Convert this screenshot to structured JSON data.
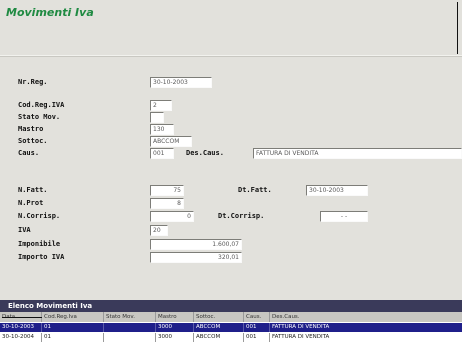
{
  "window": {
    "title": "Movimenti Iva"
  },
  "form": {
    "nr_reg": {
      "label": "Nr.Reg.",
      "value": "30-10-2003"
    },
    "cod_reg_iva": {
      "label": "Cod.Reg.IVA",
      "value": "2"
    },
    "stato_mov": {
      "label": "Stato Mov.",
      "value": ""
    },
    "mastro": {
      "label": "Mastro",
      "value": "130"
    },
    "sottoc": {
      "label": "Sottoc.",
      "value": "ABCCOM"
    },
    "caus": {
      "label": "Caus.",
      "value": "001"
    },
    "des_caus": {
      "label": "Des.Caus.",
      "value": "FATTURA DI VENDITA"
    },
    "n_fatt": {
      "label": "N.Fatt.",
      "value": "75"
    },
    "dt_fatt": {
      "label": "Dt.Fatt.",
      "value": "30-10-2003"
    },
    "n_prot": {
      "label": "N.Prot",
      "value": "8"
    },
    "n_corrisp": {
      "label": "N.Corrisp.",
      "value": "0"
    },
    "dt_corrisp": {
      "label": "Dt.Corrisp.",
      "value": "- -"
    },
    "iva": {
      "label": "IVA",
      "value": "20"
    },
    "imponibile": {
      "label": "Imponibile",
      "value": "1.600,07"
    },
    "importo_iva": {
      "label": "Importo IVA",
      "value": "320,01"
    }
  },
  "grid": {
    "title": "Elenco Movimenti Iva",
    "columns": [
      "Data",
      "Cod.Reg.Iva",
      "Stato Mov.",
      "Mastro",
      "Sottoc.",
      "Caus.",
      "Des.Caus."
    ],
    "rows": [
      [
        "30-10-2003",
        "01",
        "",
        "3000",
        "ABCCOM",
        "001",
        "FATTURA DI VENDITA"
      ],
      [
        "30-10-2004",
        "01",
        "",
        "3000",
        "ABCCOM",
        "001",
        "FATTURA DI VENDITA"
      ]
    ]
  }
}
